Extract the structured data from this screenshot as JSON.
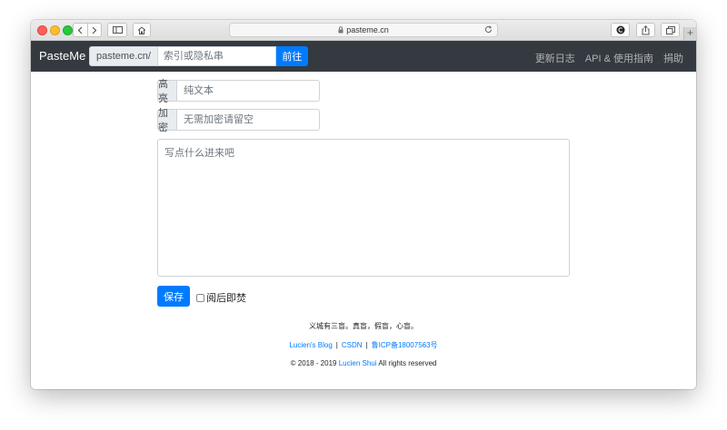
{
  "browser": {
    "url_display": "pasteme.cn",
    "new_tab_symbol": "+"
  },
  "navbar": {
    "brand": "PasteMe",
    "url_prefix": "pasteme.cn/",
    "key_placeholder": "索引或隐私串",
    "go_label": "前往",
    "links": [
      "更新日志",
      "API & 使用指南",
      "捐助"
    ]
  },
  "form": {
    "highlight_label": "高亮",
    "highlight_placeholder": "纯文本",
    "password_label": "加密",
    "password_placeholder": "无需加密请留空",
    "content_placeholder": "写点什么进来吧",
    "save_label": "保存",
    "burn_label": "阅后即焚",
    "burn_checked": false
  },
  "footer": {
    "quote": "义城有三盲。真盲，假盲，心盲。",
    "links": [
      "Lucien's Blog",
      "CSDN",
      "鲁ICP备18007563号"
    ],
    "separator": "|",
    "copyright_prefix": "© 2018 - 2019",
    "copyright_author": "Lucien Shui",
    "copyright_suffix": "All rights reserved"
  },
  "icons": {
    "sidebar": "sidebar-icon",
    "home": "home-icon",
    "lock": "lock-icon",
    "reload": "reload-icon",
    "extension": "extension-icon",
    "share": "share-icon",
    "tabs": "tabs-icon",
    "chat": "chat-icon"
  },
  "colors": {
    "primary": "#007bff",
    "navbar_bg": "#343a40",
    "chat": "#1e88e5"
  }
}
